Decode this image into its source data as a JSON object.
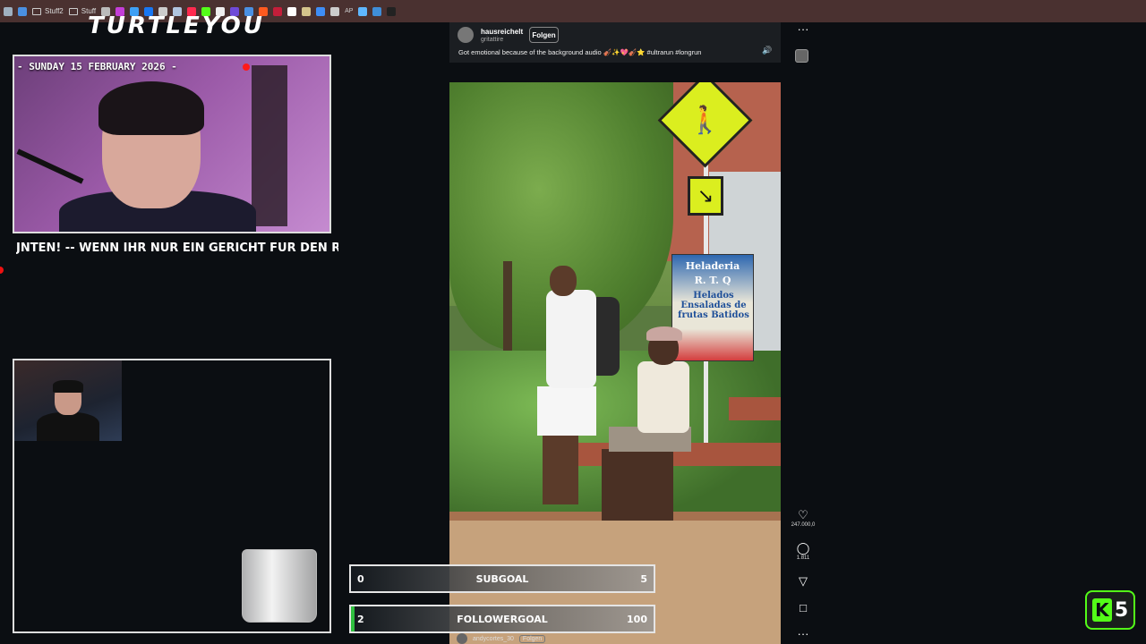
{
  "browser": {
    "bookmarks": [
      {
        "type": "icon",
        "color": "#9fb0c0"
      },
      {
        "type": "icon",
        "color": "#4a90e2"
      },
      {
        "type": "folder",
        "label": "Stuff2"
      },
      {
        "type": "folder",
        "label": "Stuff"
      },
      {
        "type": "icon",
        "color": "#bbbbbb"
      },
      {
        "type": "icon",
        "color": "#c43ed8"
      },
      {
        "type": "icon",
        "color": "#3ea0f5"
      },
      {
        "type": "icon",
        "color": "#1877f2"
      },
      {
        "type": "icon",
        "color": "#cccccc"
      },
      {
        "type": "icon",
        "color": "#b0c4de"
      },
      {
        "type": "icon",
        "color": "#ff2a4f"
      },
      {
        "type": "icon",
        "color": "#53fc18"
      },
      {
        "type": "icon",
        "color": "#eeeeee"
      },
      {
        "type": "icon",
        "color": "#6f4ad8"
      },
      {
        "type": "icon",
        "color": "#4a90e2"
      },
      {
        "type": "icon",
        "color": "#ff5a1f"
      },
      {
        "type": "icon",
        "color": "#c41e3a"
      },
      {
        "type": "icon",
        "color": "#ffffff"
      },
      {
        "type": "icon",
        "color": "#d4c48c"
      },
      {
        "type": "icon",
        "color": "#3e8ef7"
      },
      {
        "type": "icon",
        "color": "#cccccc"
      },
      {
        "type": "text",
        "label": "AP"
      },
      {
        "type": "icon",
        "color": "#5fb7ff"
      },
      {
        "type": "icon",
        "color": "#3f8ed8"
      },
      {
        "type": "icon",
        "color": "#222222"
      }
    ]
  },
  "overlay": {
    "brand": "TURTLEYOU",
    "date": "- SUNDAY 15 FEBRUARY 2026 -",
    "ticker": "JNTEN!  -- WENN IHR NUR EIN GERICHT FÜR DEN REST DES JAHRES"
  },
  "video": {
    "username": "hausreichelt",
    "sub": "gritattire",
    "follow": "Folgen",
    "caption": "Got emotional because of the background audio 🎻✨💖🎻⭐ #ultrarun #longrun",
    "billboard": {
      "title": "Heladeria",
      "sub": "R. T. Q",
      "body": "Helados Ensaladas de frutas Batidos"
    }
  },
  "side_actions": {
    "more_top": "···",
    "likes": "247.000,0",
    "comments": "1.811",
    "more_bottom": "···"
  },
  "goals": [
    {
      "name": "SUBGOAL",
      "current": "0",
      "target": "5",
      "progress": 0.0
    },
    {
      "name": "FOLLOWERGOAL",
      "current": "2",
      "target": "100",
      "progress": 0.02
    }
  ],
  "comment": {
    "user": "andycortes_30",
    "follow": "Folgen"
  },
  "kick_badge": {
    "letter": "K",
    "count": "5"
  }
}
